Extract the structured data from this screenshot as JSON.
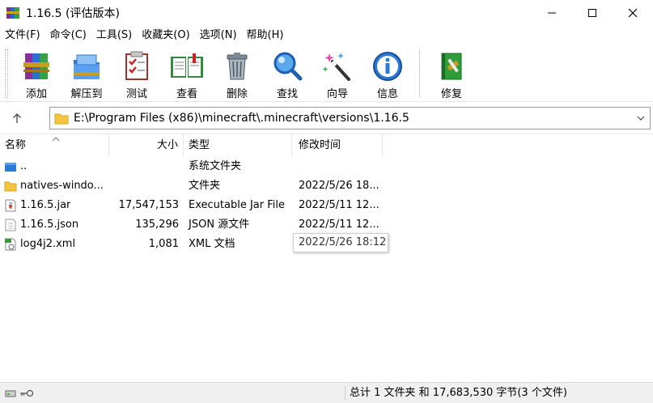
{
  "window": {
    "title": "1.16.5 (评估版本)"
  },
  "menu": [
    "文件(F)",
    "命令(C)",
    "工具(S)",
    "收藏夹(O)",
    "选项(N)",
    "帮助(H)"
  ],
  "toolbar": {
    "items": [
      {
        "label": "添加",
        "icon": "add-archive-icon"
      },
      {
        "label": "解压到",
        "icon": "extract-to-icon"
      },
      {
        "label": "测试",
        "icon": "test-icon"
      },
      {
        "label": "查看",
        "icon": "view-book-icon"
      },
      {
        "label": "删除",
        "icon": "trash-icon"
      },
      {
        "label": "查找",
        "icon": "magnifier-icon"
      },
      {
        "label": "向导",
        "icon": "wizard-wand-icon"
      },
      {
        "label": "信息",
        "icon": "info-icon"
      },
      {
        "label": "修复",
        "icon": "repair-book-icon"
      }
    ]
  },
  "path": {
    "value": "E:\\Program Files (x86)\\minecraft\\.minecraft\\versions\\1.16.5"
  },
  "columns": {
    "name": "名称",
    "size": "大小",
    "type": "类型",
    "modified": "修改时间"
  },
  "files": [
    {
      "name": "..",
      "size": "",
      "type": "系统文件夹",
      "modified": "",
      "icon": "parent-folder-icon"
    },
    {
      "name": "natives-windo...",
      "size": "",
      "type": "文件夹",
      "modified": "2022/5/26 18...",
      "icon": "folder-icon"
    },
    {
      "name": "1.16.5.jar",
      "size": "17,547,153",
      "type": "Executable Jar File",
      "modified": "2022/5/11 12...",
      "icon": "jar-file-icon"
    },
    {
      "name": "1.16.5.json",
      "size": "135,296",
      "type": "JSON 源文件",
      "modified": "2022/5/11 12...",
      "icon": "json-file-icon"
    },
    {
      "name": "log4j2.xml",
      "size": "1,081",
      "type": "XML 文档",
      "modified": "",
      "icon": "xml-file-icon"
    }
  ],
  "tooltip": {
    "text": "2022/5/26 18:12"
  },
  "status": {
    "text": "总计 1 文件夹 和 17,683,530 字节(3 个文件)"
  },
  "colors": {
    "accent_blue": "#2b79d8",
    "folder_yellow": "#f5c542",
    "status_bg": "#f0f0f0"
  }
}
